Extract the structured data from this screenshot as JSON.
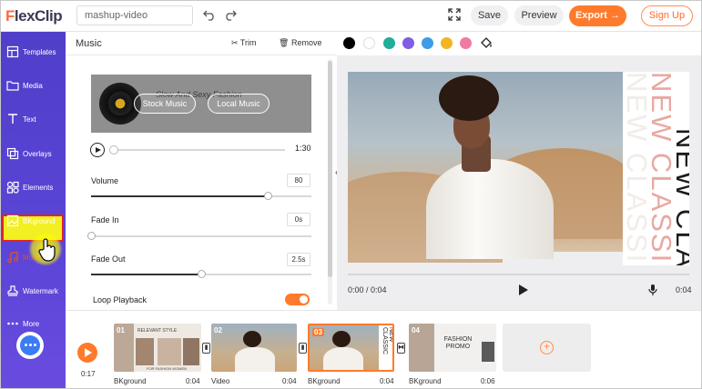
{
  "app": {
    "logo_f": "F",
    "logo_rest": "lexClip",
    "project_name": "mashup-video"
  },
  "toolbar": {
    "save_label": "Save",
    "preview_label": "Preview",
    "export_label": "Export",
    "signup_label": "Sign Up"
  },
  "sidebar": {
    "items": [
      {
        "label": "Templates",
        "icon": "templates-icon"
      },
      {
        "label": "Media",
        "icon": "media-folder-icon"
      },
      {
        "label": "Text",
        "icon": "text-icon"
      },
      {
        "label": "Overlays",
        "icon": "overlays-icon"
      },
      {
        "label": "Elements",
        "icon": "elements-icon"
      },
      {
        "label": "BKground",
        "icon": "background-icon"
      },
      {
        "label": "Music",
        "icon": "music-icon"
      },
      {
        "label": "Watermark",
        "icon": "watermark-icon"
      },
      {
        "label": "More",
        "icon": "more-dots-icon"
      }
    ],
    "selected": "Music"
  },
  "music_panel": {
    "title": "Music",
    "trim_label": "Trim",
    "remove_label": "Remove",
    "track_name": "Slow And Sexy Fashion",
    "stock_music_label": "Stock Music",
    "local_music_label": "Local Music",
    "duration": "1:30",
    "volume_label": "Volume",
    "volume_value": "80",
    "volume_level": 0.8,
    "fade_in_label": "Fade In",
    "fade_in_value": "0s",
    "fade_in_level": 0,
    "fade_out_label": "Fade Out",
    "fade_out_value": "2.5s",
    "fade_out_level": 0.5,
    "loop_label": "Loop Playback",
    "loop_on": true
  },
  "colors": {
    "swatches": [
      "#000000",
      "#ffffff",
      "#1fae9a",
      "#7f5de4",
      "#3d9be9",
      "#f2b523",
      "#f07aa3"
    ],
    "accent": "#ff7a2a",
    "sidebar": "#5542d0"
  },
  "preview": {
    "overlay_lines": [
      {
        "text": "NEW CLASSIC",
        "color": "#f2ece9"
      },
      {
        "text": "NEW CLASSIC",
        "color": "#e8a9a3"
      },
      {
        "text": "NEW CLASSIC",
        "color": "#1c1c1c"
      }
    ],
    "time_display": "0:00 / 0:04",
    "end_time": "0:04"
  },
  "timeline": {
    "current_time": "0:17",
    "clips": [
      {
        "number": "01",
        "label": "BKground",
        "duration": "0:04"
      },
      {
        "number": "02",
        "label": "Video",
        "duration": "0:04"
      },
      {
        "number": "03",
        "label": "BKground",
        "duration": "0:04"
      },
      {
        "number": "04",
        "label": "BKground",
        "duration": "0:06"
      }
    ],
    "clip1_title": "RELEVANT STYLE",
    "clip1_footer": "FOR FASHION WOMEN",
    "clip4_title": "FASHION PROMO"
  }
}
